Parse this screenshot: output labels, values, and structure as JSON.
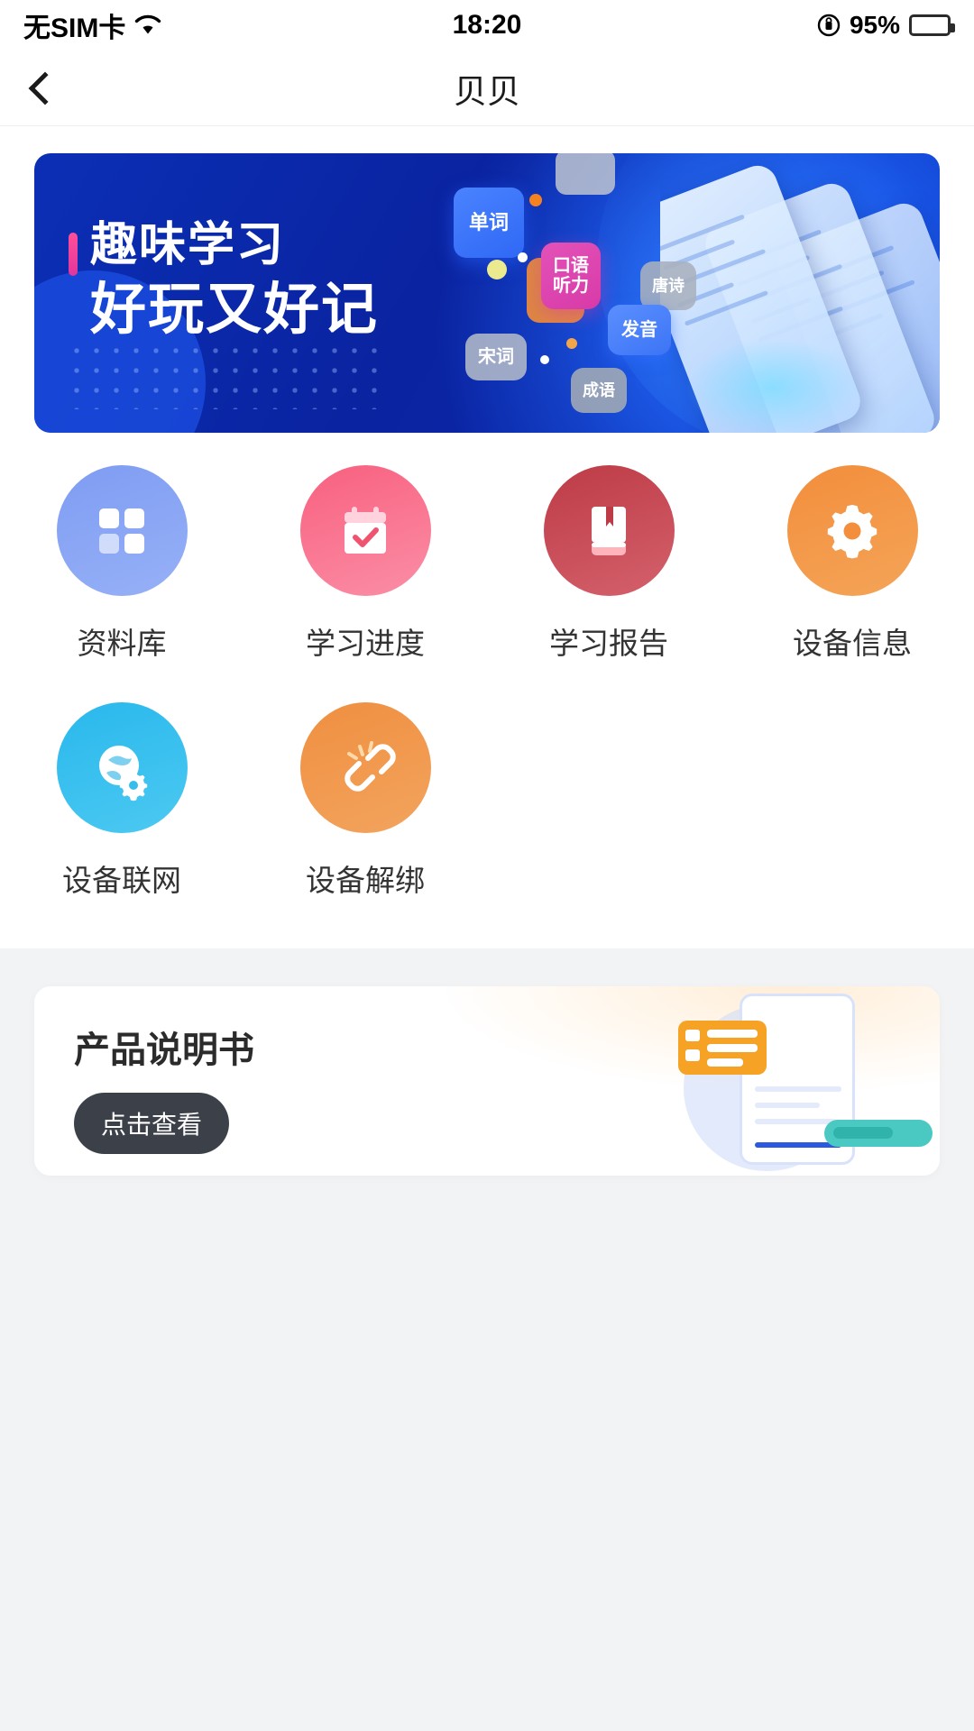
{
  "status_bar": {
    "carrier": "无SIM卡",
    "wifi_icon": "wifi-icon",
    "time": "18:20",
    "rotation_lock_icon": "rotation-lock-icon",
    "battery_percent": "95%",
    "battery_icon": "battery-icon"
  },
  "nav": {
    "back_icon": "chevron-left-icon",
    "title": "贝贝"
  },
  "banner": {
    "accent_color": "#ff4f9a",
    "background_color": "#0a23a0",
    "line1": "趣味学习",
    "line2": "好玩又好记",
    "tags": [
      {
        "label": "单词",
        "color": "#3f78f8"
      },
      {
        "label": "口语\n听力",
        "line1": "口语",
        "line2": "听力",
        "color": "#d83aa8"
      },
      {
        "label": "唐诗",
        "color": "#a8b0be"
      },
      {
        "label": "发音",
        "color": "#3c74f5"
      },
      {
        "label": "宋词",
        "color": "#b2bac8"
      },
      {
        "label": "成语",
        "color": "#a0a8b6"
      }
    ]
  },
  "grid": {
    "items": [
      {
        "label": "资料库",
        "icon": "grid-squares-icon",
        "color": "#8ba5f4"
      },
      {
        "label": "学习进度",
        "icon": "calendar-check-icon",
        "color": "#f8607f"
      },
      {
        "label": "学习报告",
        "icon": "book-bookmark-icon",
        "color": "#bd3b46"
      },
      {
        "label": "设备信息",
        "icon": "gear-icon",
        "color": "#f28e3c"
      },
      {
        "label": "设备联网",
        "icon": "globe-gear-icon",
        "color": "#29b8ec"
      },
      {
        "label": "设备解绑",
        "icon": "broken-chain-link-icon",
        "color": "#ef8f40"
      }
    ]
  },
  "manual_card": {
    "title": "产品说明书",
    "button_label": "点击查看",
    "illustration_icon": "document-list-icon",
    "button_color": "#3c4049"
  }
}
